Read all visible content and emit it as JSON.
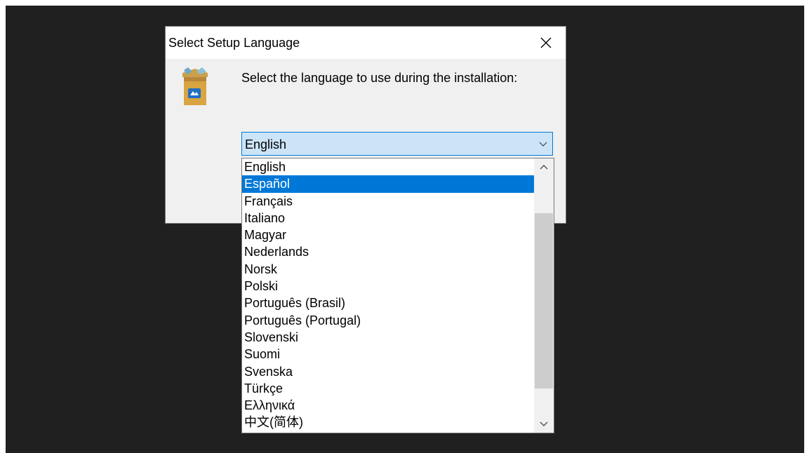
{
  "dialog": {
    "title": "Select Setup Language",
    "prompt": "Select the language to use during the installation:",
    "combo_value": "English",
    "icons": {
      "close": "close-icon",
      "app": "setup-box-icon",
      "combo_arrow": "chevron-down-icon",
      "scroll_up": "chevron-up-icon",
      "scroll_down": "chevron-down-icon"
    }
  },
  "dropdown": {
    "items": [
      {
        "label": "English"
      },
      {
        "label": "Español"
      },
      {
        "label": "Français"
      },
      {
        "label": "Italiano"
      },
      {
        "label": "Magyar"
      },
      {
        "label": "Nederlands"
      },
      {
        "label": "Norsk"
      },
      {
        "label": "Polski"
      },
      {
        "label": "Português (Brasil)"
      },
      {
        "label": "Português (Portugal)"
      },
      {
        "label": "Slovenski"
      },
      {
        "label": "Suomi"
      },
      {
        "label": "Svenska"
      },
      {
        "label": "Türkçe"
      },
      {
        "label": "Ελληνικά"
      },
      {
        "label": "中文(简体)"
      }
    ],
    "highlighted_item": "Español"
  },
  "colors": {
    "backdrop": "#202020",
    "selection": "#0078d7",
    "combo_fill": "#cce4f7"
  }
}
